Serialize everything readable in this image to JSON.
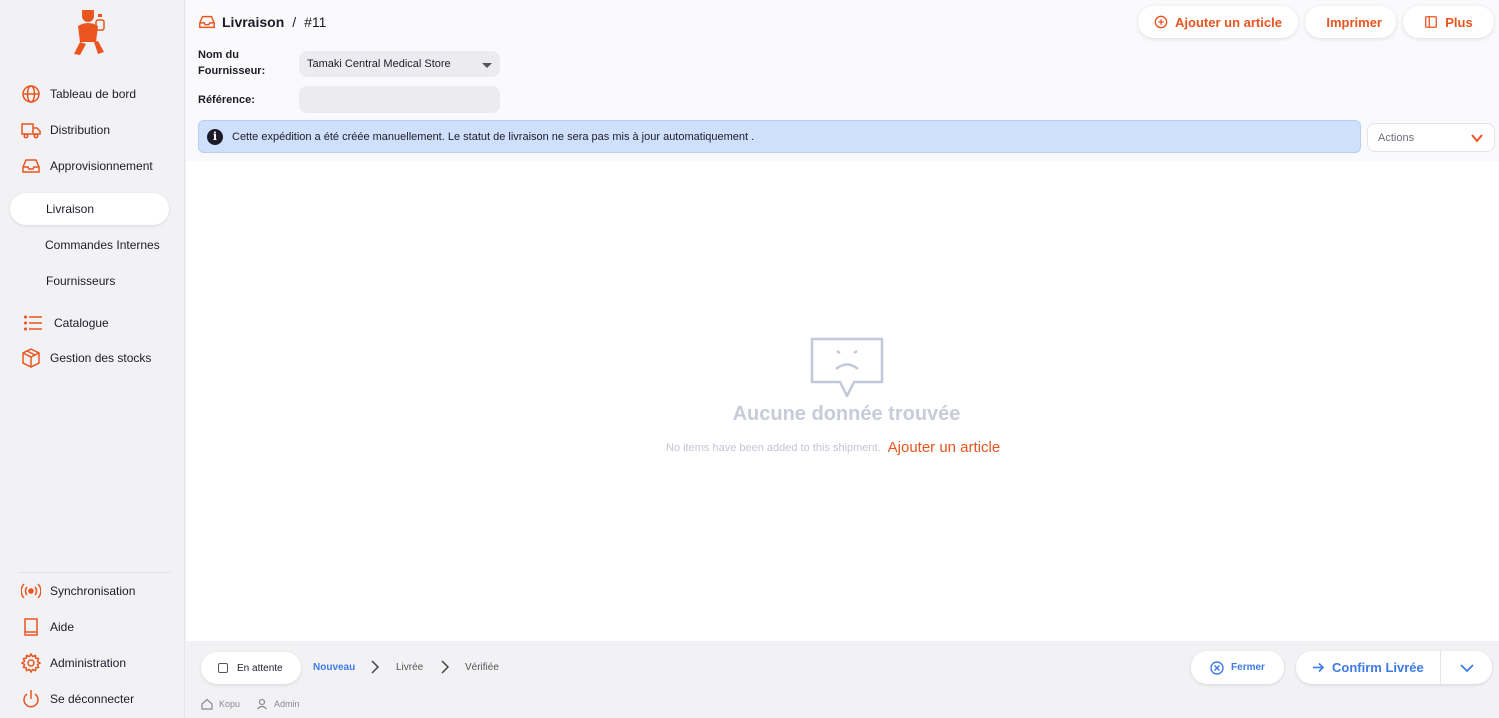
{
  "colors": {
    "accent": "#e9541f",
    "primary_blue": "#3e7be6",
    "info_bg": "#cfe0fd"
  },
  "sidebar": {
    "logo": "app-logo",
    "items": [
      {
        "label": "Tableau de bord",
        "icon": "globe-icon"
      },
      {
        "label": "Distribution",
        "icon": "truck-icon"
      },
      {
        "label": "Approvisionnement",
        "icon": "inbox-icon"
      },
      {
        "label": "Catalogue",
        "icon": "list-icon"
      },
      {
        "label": "Gestion des stocks",
        "icon": "box-icon"
      }
    ],
    "sub_items": [
      {
        "label": "Livraison",
        "active": true
      },
      {
        "label": "Commandes Internes",
        "active": false
      },
      {
        "label": "Fournisseurs",
        "active": false
      }
    ],
    "bottom_items": [
      {
        "label": "Synchronisation",
        "icon": "broadcast-icon"
      },
      {
        "label": "Aide",
        "icon": "book-icon"
      },
      {
        "label": "Administration",
        "icon": "gear-icon"
      },
      {
        "label": "Se déconnecter",
        "icon": "power-icon"
      }
    ]
  },
  "header": {
    "breadcrumb_section": "Livraison",
    "breadcrumb_sep": "/",
    "breadcrumb_id": "#11",
    "buttons": {
      "add_item": "Ajouter un article",
      "print": "Imprimer",
      "more": "Plus"
    },
    "supplier_label": "Nom du Fournisseur:",
    "supplier_value": "Tamaki Central Medical Store",
    "reference_label": "Référence:",
    "reference_value": "",
    "info_message": "Cette expédition a été créée manuellement. Le statut de livraison ne sera pas mis à jour automatiquement .",
    "actions_placeholder": "Actions"
  },
  "main": {
    "empty_title": "Aucune donnée trouvée",
    "empty_text": "No items have been added to this shipment.",
    "empty_link": "Ajouter un article"
  },
  "footer": {
    "on_hold_label": "En attente",
    "steps": [
      "Nouveau",
      "Livrée",
      "Vérifiée"
    ],
    "active_step": "Nouveau",
    "close_label": "Fermer",
    "confirm_label": "Confirm Livrée",
    "store_name": "Kopu",
    "user_name": "Admin"
  }
}
